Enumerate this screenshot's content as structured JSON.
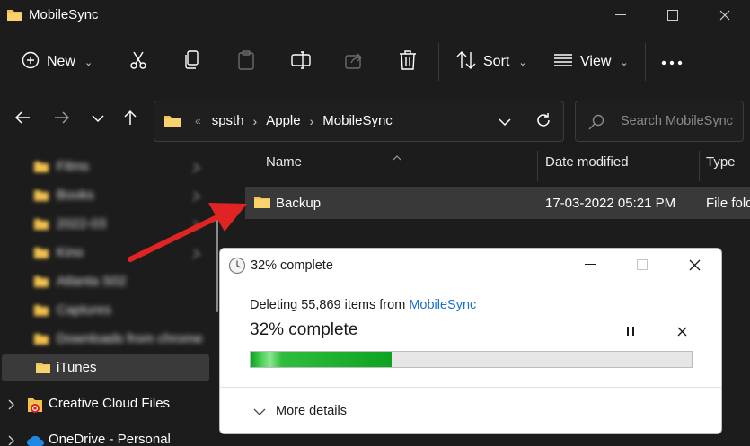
{
  "window": {
    "title": "MobileSync"
  },
  "toolbar": {
    "new_label": "New",
    "sort_label": "Sort",
    "view_label": "View"
  },
  "address": {
    "crumbs": [
      "spsth",
      "Apple",
      "MobileSync"
    ]
  },
  "search": {
    "placeholder": "Search MobileSync"
  },
  "sidebar": {
    "items": [
      {
        "label": "Films",
        "blurred": true
      },
      {
        "label": "Books",
        "blurred": true
      },
      {
        "label": "2022-03",
        "blurred": true
      },
      {
        "label": "Kino",
        "blurred": true
      },
      {
        "label": "Atlanta S02",
        "blurred": true
      },
      {
        "label": "Captures",
        "blurred": true
      },
      {
        "label": "Downloads from chrome",
        "blurred": true
      },
      {
        "label": "iTunes",
        "blurred": false,
        "selected": true
      },
      {
        "label": "Creative Cloud Files",
        "blurred": false
      },
      {
        "label": "OneDrive - Personal",
        "blurred": false
      }
    ]
  },
  "columns": {
    "name": "Name",
    "date": "Date modified",
    "type": "Type"
  },
  "files": [
    {
      "name": "Backup",
      "date": "17-03-2022 05:21 PM",
      "type": "File folder"
    }
  ],
  "dialog": {
    "title": "32% complete",
    "message_prefix": "Deleting 55,869 items from ",
    "message_link": "MobileSync",
    "percent_text": "32% complete",
    "progress": 0.32,
    "more_details": "More details"
  },
  "colors": {
    "background": "#1c1c1c",
    "selected_row": "#393939",
    "progress_green": "#0ea322",
    "link_blue": "#1a6fc8",
    "arrow_red": "#e02424",
    "folder_yellow": "#f2c14e"
  }
}
